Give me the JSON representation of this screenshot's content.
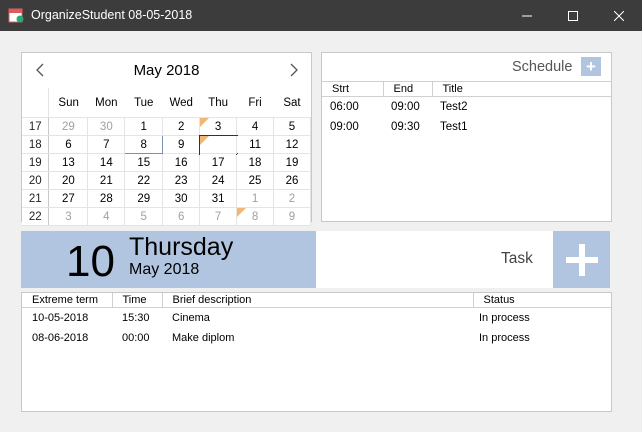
{
  "window": {
    "title": "OrganizeStudent 08-05-2018"
  },
  "calendar": {
    "month_label": "May 2018",
    "weekdays": [
      "Sun",
      "Mon",
      "Tue",
      "Wed",
      "Thu",
      "Fri",
      "Sat"
    ],
    "weeks": [
      {
        "week": "17",
        "days": [
          {
            "d": "29",
            "other": true
          },
          {
            "d": "30",
            "other": true
          },
          {
            "d": "1"
          },
          {
            "d": "2"
          },
          {
            "d": "3",
            "flag": true
          },
          {
            "d": "4"
          },
          {
            "d": "5"
          }
        ]
      },
      {
        "week": "18",
        "days": [
          {
            "d": "6"
          },
          {
            "d": "7"
          },
          {
            "d": "8",
            "today": true
          },
          {
            "d": "9"
          },
          {
            "d": "10",
            "selected": true,
            "flag": true
          },
          {
            "d": "11"
          },
          {
            "d": "12"
          }
        ]
      },
      {
        "week": "19",
        "days": [
          {
            "d": "13"
          },
          {
            "d": "14"
          },
          {
            "d": "15"
          },
          {
            "d": "16"
          },
          {
            "d": "17"
          },
          {
            "d": "18"
          },
          {
            "d": "19"
          }
        ]
      },
      {
        "week": "20",
        "days": [
          {
            "d": "20"
          },
          {
            "d": "21"
          },
          {
            "d": "22"
          },
          {
            "d": "23"
          },
          {
            "d": "24"
          },
          {
            "d": "25"
          },
          {
            "d": "26"
          }
        ]
      },
      {
        "week": "21",
        "days": [
          {
            "d": "27"
          },
          {
            "d": "28"
          },
          {
            "d": "29"
          },
          {
            "d": "30"
          },
          {
            "d": "31"
          },
          {
            "d": "1",
            "other": true
          },
          {
            "d": "2",
            "other": true
          }
        ]
      },
      {
        "week": "22",
        "days": [
          {
            "d": "3",
            "other": true
          },
          {
            "d": "4",
            "other": true
          },
          {
            "d": "5",
            "other": true
          },
          {
            "d": "6",
            "other": true
          },
          {
            "d": "7",
            "other": true
          },
          {
            "d": "8",
            "other": true,
            "flag": true
          },
          {
            "d": "9",
            "other": true
          }
        ]
      }
    ]
  },
  "schedule": {
    "label": "Schedule",
    "add_label": "+",
    "columns": [
      "Strt",
      "End",
      "Title"
    ],
    "rows": [
      {
        "start": "06:00",
        "end": "09:00",
        "title": "Test2"
      },
      {
        "start": "09:00",
        "end": "09:30",
        "title": "Test1"
      }
    ]
  },
  "day_banner": {
    "day": "10",
    "weekday": "Thursday",
    "month_year": "May 2018"
  },
  "task_header": {
    "label": "Task"
  },
  "tasks": {
    "columns": [
      "Extreme term",
      "Time",
      "Brief description",
      "Status"
    ],
    "rows": [
      {
        "term": "10-05-2018",
        "time": "15:30",
        "desc": "Cinema",
        "status": "In process"
      },
      {
        "term": "08-06-2018",
        "time": "00:00",
        "desc": "Make diplom",
        "status": "In process"
      }
    ]
  },
  "colors": {
    "accent": "#b2c5e0",
    "selected": "#0000e6",
    "flag": "#f3b774",
    "titlebar": "#3c3c3c"
  },
  "icons": {
    "app": "calendar-icon",
    "prev": "chevron-left-icon",
    "next": "chevron-right-icon",
    "add": "plus-icon"
  }
}
